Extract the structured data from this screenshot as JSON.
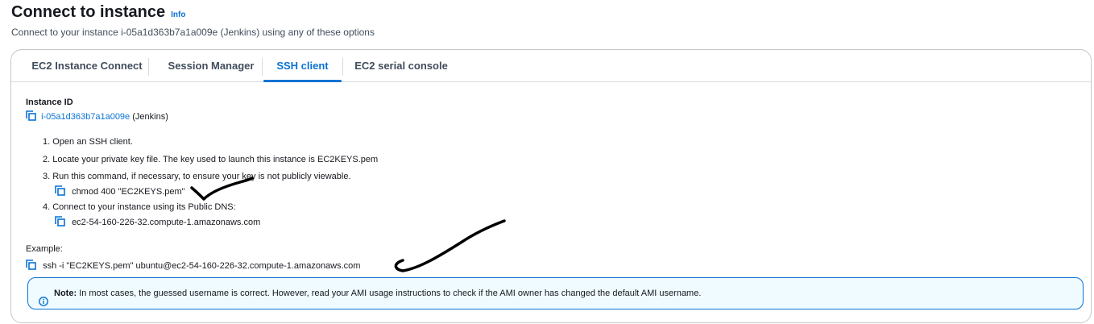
{
  "header": {
    "title": "Connect to instance",
    "info_label": "Info",
    "subtitle": "Connect to your instance i-05a1d363b7a1a009e (Jenkins) using any of these options"
  },
  "tabs": [
    {
      "label": "EC2 Instance Connect",
      "active": false
    },
    {
      "label": "Session Manager",
      "active": false
    },
    {
      "label": "SSH client",
      "active": true
    },
    {
      "label": "EC2 serial console",
      "active": false
    }
  ],
  "instance": {
    "label": "Instance ID",
    "id": "i-05a1d363b7a1a009e",
    "name": "(Jenkins)"
  },
  "steps": [
    {
      "text": "1. Open an SSH client."
    },
    {
      "text": "2. Locate your private key file. The key used to launch this instance is EC2KEYS.pem"
    },
    {
      "text": "3. Run this command, if necessary, to ensure your key is not publicly viewable.",
      "command": "chmod 400 \"EC2KEYS.pem\""
    },
    {
      "text": "4. Connect to your instance using its Public DNS:",
      "command": "ec2-54-160-226-32.compute-1.amazonaws.com"
    }
  ],
  "example": {
    "label": "Example:",
    "command": "ssh -i \"EC2KEYS.pem\" ubuntu@ec2-54-160-226-32.compute-1.amazonaws.com"
  },
  "note": {
    "strong": "Note:",
    "text": " In most cases, the guessed username is correct. However, read your AMI usage instructions to check if the AMI owner has changed the default AMI username."
  },
  "colors": {
    "accent": "#0972d3",
    "note_background": "#f0fbff",
    "annotation_ink": "#000000"
  },
  "icons": [
    "copy-icon",
    "info-circle-icon"
  ]
}
